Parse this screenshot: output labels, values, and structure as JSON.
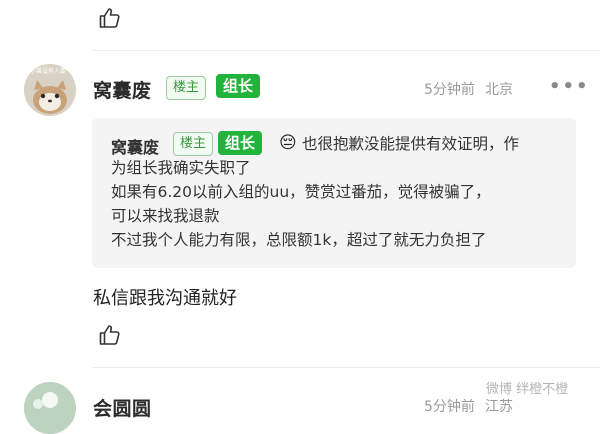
{
  "comment": {
    "username": "窝囊废",
    "badge_owner": "楼主",
    "badge_leader": "组长",
    "time": "5分钟前",
    "location": "北京",
    "more_label": "•••",
    "avatar_caption": "小兽没有人要",
    "quote": {
      "username": "窝囊废",
      "badge_owner": "楼主",
      "badge_leader": "组长",
      "emoji": "😔",
      "lines": [
        "也很抱歉没能提供有效证明，作",
        "为组长我确实失职了",
        "如果有6.20以前入组的uu，赞赏过番茄，觉得被骗了，",
        "可以来找我退款",
        "不过我个人能力有限，总限额1k，超过了就无力负担了"
      ]
    },
    "reply_text": "私信跟我沟通就好"
  },
  "next_comment": {
    "username": "会圆圆",
    "time": "5分钟前",
    "location": "江苏"
  },
  "watermark": "微博 绊橙不橙",
  "colors": {
    "leader_badge": "#21b33b",
    "owner_badge_text": "#3a9a3e",
    "quote_bg": "#f4f4f4"
  }
}
